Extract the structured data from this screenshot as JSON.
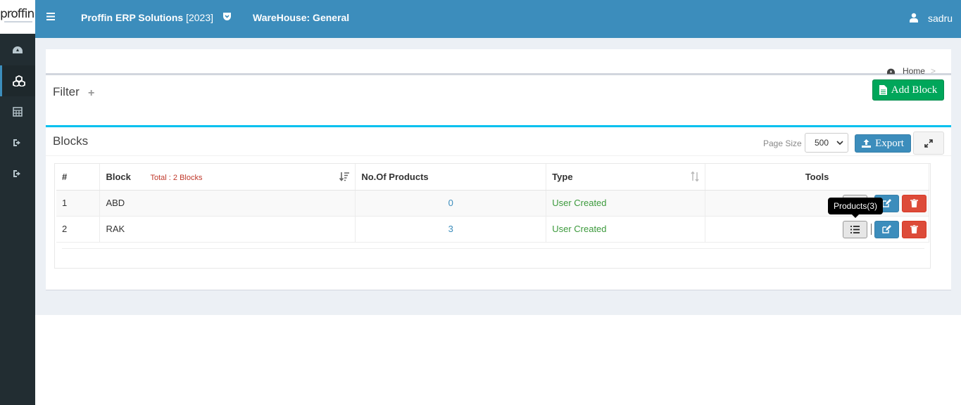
{
  "logo": {
    "text": "proffin"
  },
  "topbar": {
    "brand": "Proffin ERP Solutions",
    "year": "[2023]",
    "warehouse": "WareHouse: General",
    "user": "sadru"
  },
  "breadcrumb": {
    "home": "Home",
    "separator": ">"
  },
  "filter": {
    "title": "Filter",
    "add_label": "Add Block"
  },
  "blocks": {
    "title": "Blocks",
    "page_size_label": "Page Size",
    "page_size_value": "500",
    "export_label": "Export"
  },
  "table": {
    "columns": [
      "#",
      "Block",
      "No.Of Products",
      "Type",
      "Tools"
    ],
    "total_label": "Total : 2 Blocks",
    "rows": [
      {
        "index": "1",
        "block": "ABD",
        "products": "0",
        "type": "User Created"
      },
      {
        "index": "2",
        "block": "RAK",
        "products": "3",
        "type": "User Created"
      }
    ]
  },
  "tooltip": {
    "text": "Products(3)"
  },
  "colors": {
    "topbar": "#3c8dbc",
    "sidebar": "#222d32",
    "add_button": "#00a65a",
    "delete_button": "#dd4b39",
    "accent_strip": "#00c0ef"
  }
}
